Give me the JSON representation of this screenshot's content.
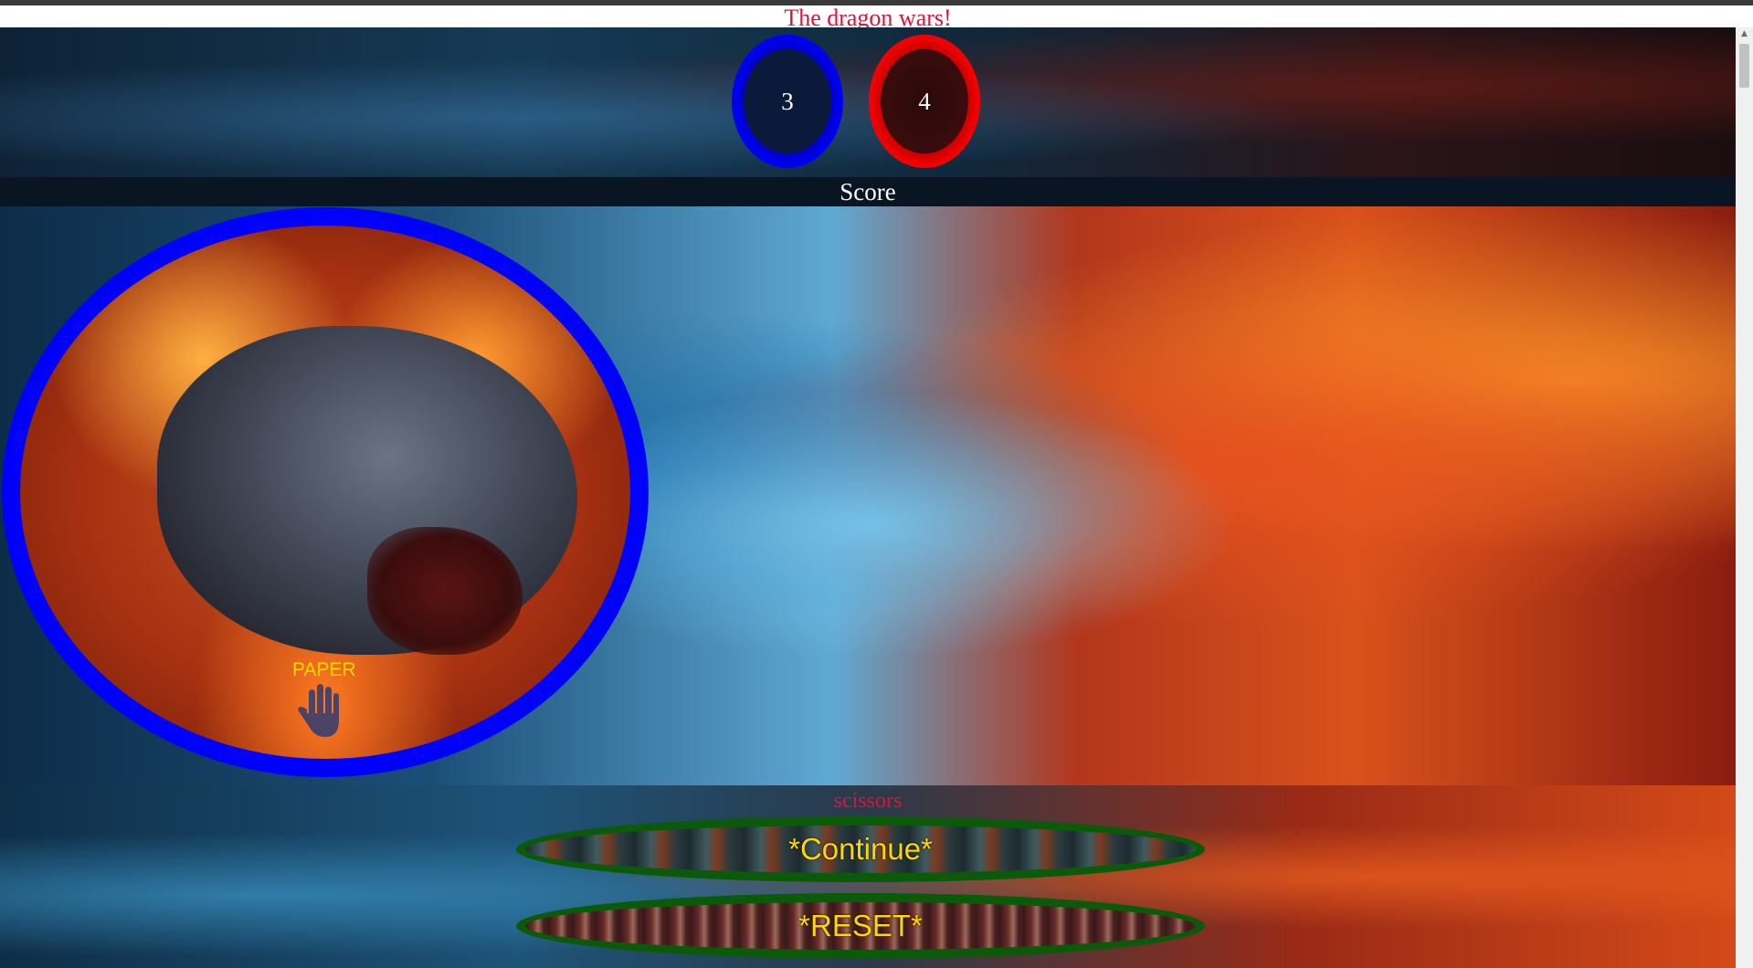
{
  "title": "The dragon wars!",
  "scores": {
    "player": "3",
    "computer": "4",
    "label": "Score"
  },
  "player_choice": {
    "label": "PAPER",
    "icon": "hand-paper-icon"
  },
  "computer_choice": {
    "label": "scissors"
  },
  "buttons": {
    "continue_label": "*Continue*",
    "reset_label": "*RESET*"
  },
  "colors": {
    "title": "#dc143c",
    "player_ring": "#0000ff",
    "computer_ring": "#ff0000",
    "button_text": "#ffd700",
    "button_border": "#0a5a0a"
  }
}
